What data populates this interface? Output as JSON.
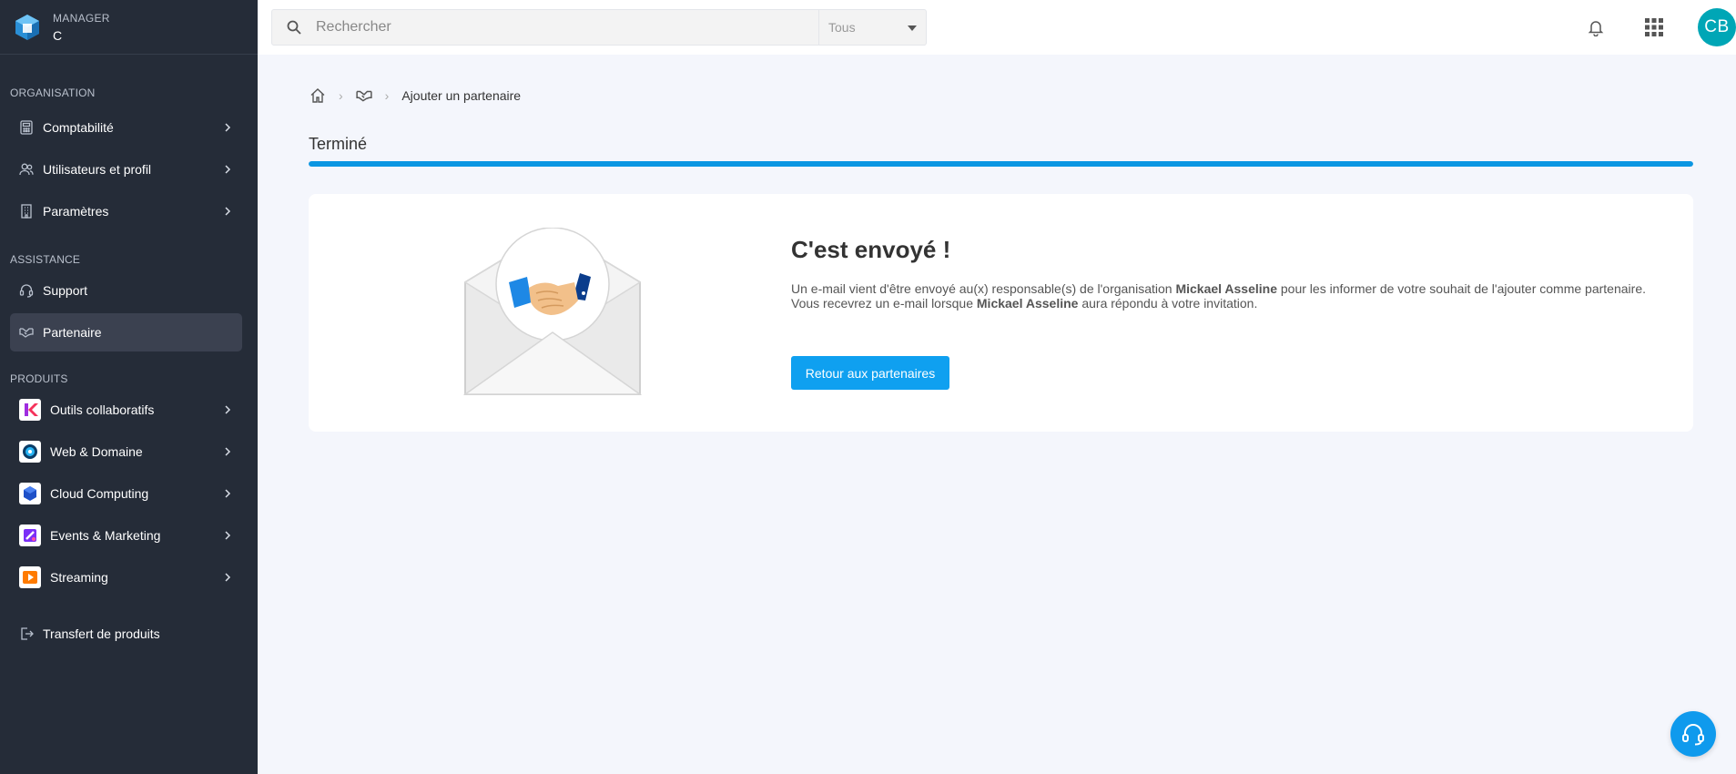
{
  "brand": {
    "sub": "MANAGER",
    "main": "C"
  },
  "sidebar": {
    "sections": [
      {
        "title": "ORGANISATION"
      },
      {
        "title": "ASSISTANCE"
      },
      {
        "title": "PRODUITS"
      }
    ],
    "org_items": [
      {
        "label": "Comptabilité",
        "icon": "calculator-icon"
      },
      {
        "label": "Utilisateurs et profil",
        "icon": "users-icon"
      },
      {
        "label": "Paramètres",
        "icon": "building-icon"
      }
    ],
    "assist_items": [
      {
        "label": "Support",
        "icon": "headset-icon"
      },
      {
        "label": "Partenaire",
        "icon": "handshake-icon"
      }
    ],
    "product_items": [
      {
        "label": "Outils collaboratifs",
        "icon": "kchat-logo-icon"
      },
      {
        "label": "Web & Domaine",
        "icon": "web-domain-logo-icon"
      },
      {
        "label": "Cloud Computing",
        "icon": "cloud-computing-logo-icon"
      },
      {
        "label": "Events & Marketing",
        "icon": "events-marketing-logo-icon"
      },
      {
        "label": "Streaming",
        "icon": "streaming-logo-icon"
      }
    ],
    "transfer": {
      "label": "Transfert de produits",
      "icon": "export-icon"
    }
  },
  "topbar": {
    "search_placeholder": "Rechercher",
    "filter_value": "Tous",
    "avatar_initials": "CB"
  },
  "breadcrumb": {
    "current": "Ajouter un partenaire"
  },
  "page": {
    "title": "Terminé",
    "progress_percent": 100
  },
  "card": {
    "heading": "C'est envoyé !",
    "line1_a": "Un e-mail vient d'être envoyé au(x) responsable(s) de l'organisation",
    "org_name": "Mickael Asseline",
    "line1_b": "pour les informer de votre souhait de l'ajouter comme partenaire.",
    "line2_a": "Vous recevrez un e-mail lorsque",
    "org_name_2": "Mickael Asseline",
    "line2_b": "aura répondu à votre invitation.",
    "button": "Retour aux partenaires"
  },
  "colors": {
    "accent": "#0fa0f0",
    "sidebar_bg": "#252c38",
    "avatar": "#00a6b6"
  }
}
